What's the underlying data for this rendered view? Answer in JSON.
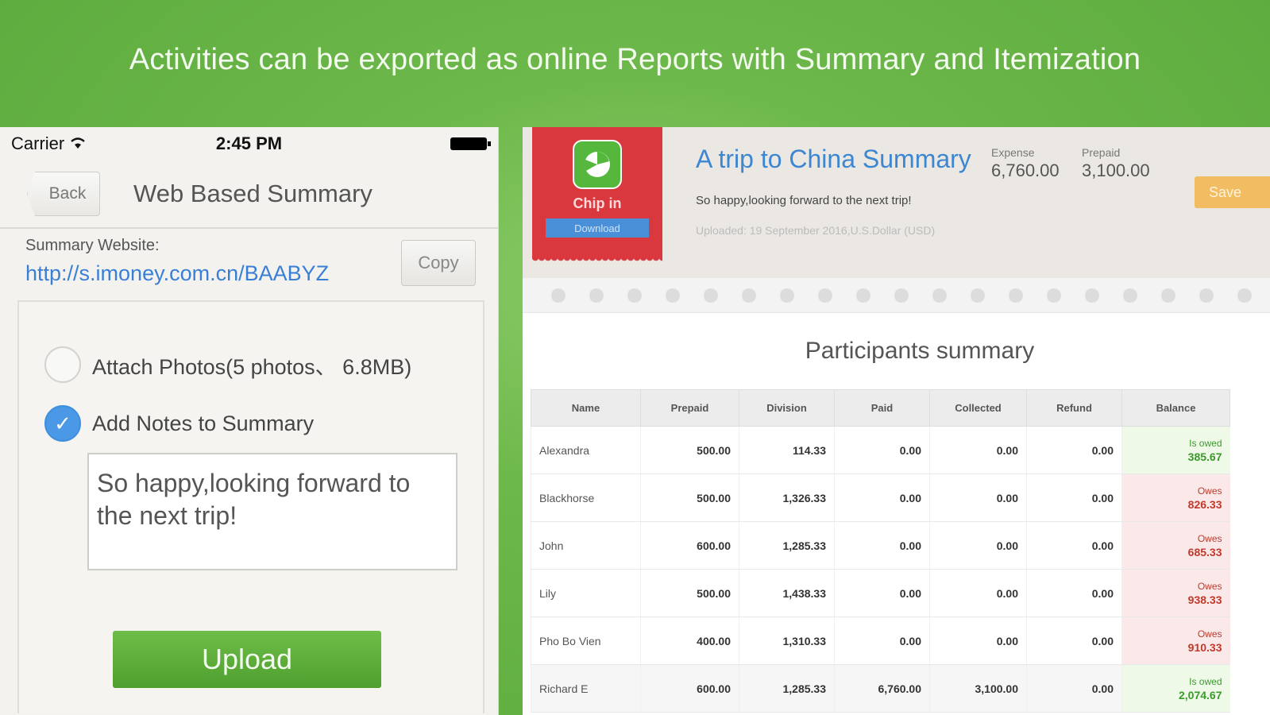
{
  "banner": {
    "text": "Activities can be exported as online Reports with Summary and Itemization"
  },
  "phone": {
    "status": {
      "carrier": "Carrier",
      "time": "2:45 PM"
    },
    "nav": {
      "back_label": "Back",
      "title": "Web Based Summary"
    },
    "website_label": "Summary Website:",
    "website_url": "http://s.imoney.com.cn/BAABYZ",
    "copy_label": "Copy",
    "attach_photos_label": "Attach Photos(5 photos、 6.8MB)",
    "add_notes_label": "Add Notes to Summary",
    "notes_text": "So happy,looking forward to the next trip!",
    "upload_label": "Upload"
  },
  "report": {
    "app_name": "Chip in",
    "download_label": "Download",
    "title": "A trip to China Summary",
    "subtitle": "So happy,looking forward to the next trip!",
    "uploaded": "Uploaded: 19 September 2016,U.S.Dollar (USD)",
    "expense_label": "Expense",
    "expense_value": "6,760.00",
    "prepaid_label": "Prepaid",
    "prepaid_value": "3,100.00",
    "save_label": "Save",
    "section_title": "Participants summary",
    "columns": [
      "Name",
      "Prepaid",
      "Division",
      "Paid",
      "Collected",
      "Refund",
      "Balance"
    ],
    "rows": [
      {
        "name": "Alexandra",
        "prepaid": "500.00",
        "division": "114.33",
        "paid": "0.00",
        "collected": "0.00",
        "refund": "0.00",
        "bal_label": "Is owed",
        "bal_value": "385.67",
        "status": "owed"
      },
      {
        "name": "Blackhorse",
        "prepaid": "500.00",
        "division": "1,326.33",
        "paid": "0.00",
        "collected": "0.00",
        "refund": "0.00",
        "bal_label": "Owes",
        "bal_value": "826.33",
        "status": "owes"
      },
      {
        "name": "John",
        "prepaid": "600.00",
        "division": "1,285.33",
        "paid": "0.00",
        "collected": "0.00",
        "refund": "0.00",
        "bal_label": "Owes",
        "bal_value": "685.33",
        "status": "owes"
      },
      {
        "name": "Lily",
        "prepaid": "500.00",
        "division": "1,438.33",
        "paid": "0.00",
        "collected": "0.00",
        "refund": "0.00",
        "bal_label": "Owes",
        "bal_value": "938.33",
        "status": "owes"
      },
      {
        "name": "Pho Bo Vien",
        "prepaid": "400.00",
        "division": "1,310.33",
        "paid": "0.00",
        "collected": "0.00",
        "refund": "0.00",
        "bal_label": "Owes",
        "bal_value": "910.33",
        "status": "owes"
      },
      {
        "name": "Richard E",
        "prepaid": "600.00",
        "division": "1,285.33",
        "paid": "6,760.00",
        "collected": "3,100.00",
        "refund": "0.00",
        "bal_label": "Is owed",
        "bal_value": "2,074.67",
        "status": "owed"
      }
    ]
  },
  "colors": {
    "banner_green": "#5aa83c",
    "link_blue": "#3a7fd6",
    "owes_red": "#c0392b",
    "owed_green": "#3a9a2a",
    "ribbon_red": "#d9383e"
  }
}
